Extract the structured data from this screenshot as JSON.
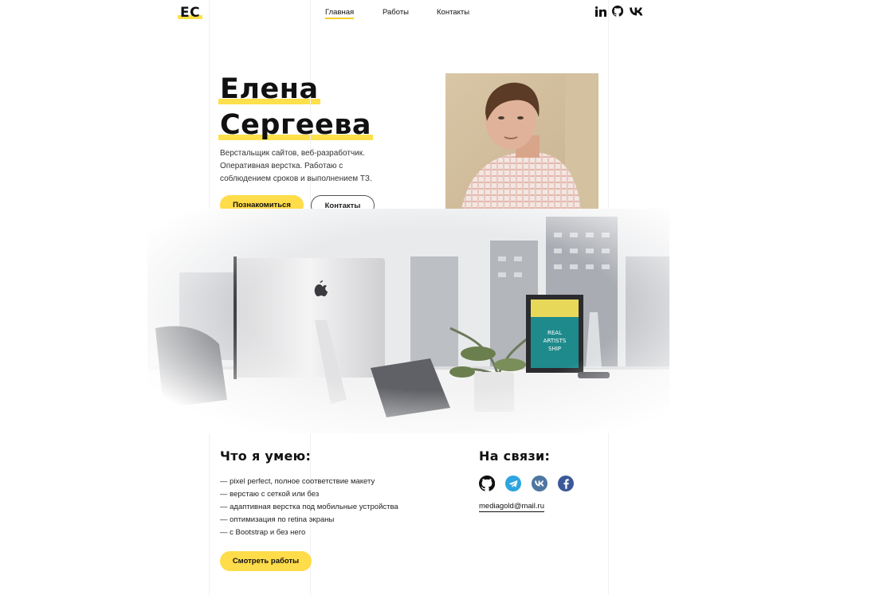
{
  "header": {
    "logo": "ЕС",
    "nav": [
      "Главная",
      "Работы",
      "Контакты"
    ],
    "social_icons": [
      "linkedin-icon",
      "github-icon",
      "vk-icon"
    ]
  },
  "hero": {
    "first_name": "Елена",
    "last_name": "Сергеева",
    "description": "Верстальщик сайтов, веб-разработчик. Оперативная верстка. Работаю с соблюдением сроков и выполнением ТЗ.",
    "primary_button": "Познакомиться",
    "secondary_button": "Контакты"
  },
  "skills": {
    "title": "Что я умею:",
    "items": [
      "— pixel perfect, полное соответствие макету",
      "— верстаю с сеткой или без",
      "— адаптивная верстка под мобильные устройства",
      "— оптимизация по retina экраны",
      "— с Bootstrap и без него"
    ],
    "button": "Смотреть работы"
  },
  "contacts": {
    "title": "На связи:",
    "icons": [
      "github-icon",
      "telegram-icon",
      "vk-icon",
      "facebook-icon"
    ],
    "email": "mediagold@mail.ru"
  },
  "colors": {
    "accent": "#ffdc4a",
    "text": "#111111",
    "telegram": "#2ca5e0",
    "vk": "#4d76a1",
    "facebook": "#3b5998"
  }
}
